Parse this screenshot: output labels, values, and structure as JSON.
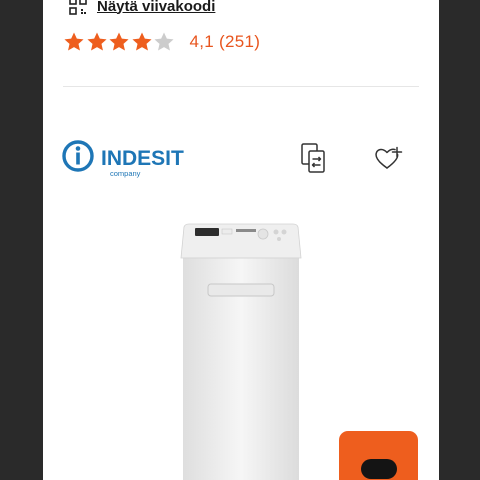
{
  "barcode": {
    "link_text": "Näytä viivakoodi",
    "icon": "barcode-icon"
  },
  "rating": {
    "value_text": "4,1 (251)",
    "stars_total": 5,
    "stars_filled": 4,
    "star_color": "#ee5e1e",
    "star_empty_color": "#cccccc"
  },
  "brand": {
    "name": "INDESIT",
    "tagline": "company",
    "color": "#1e76b6"
  },
  "actions": {
    "compare_icon": "compare-icon",
    "favorite_icon": "heart-plus-icon"
  },
  "fab": {
    "color": "#ee5e1e"
  }
}
